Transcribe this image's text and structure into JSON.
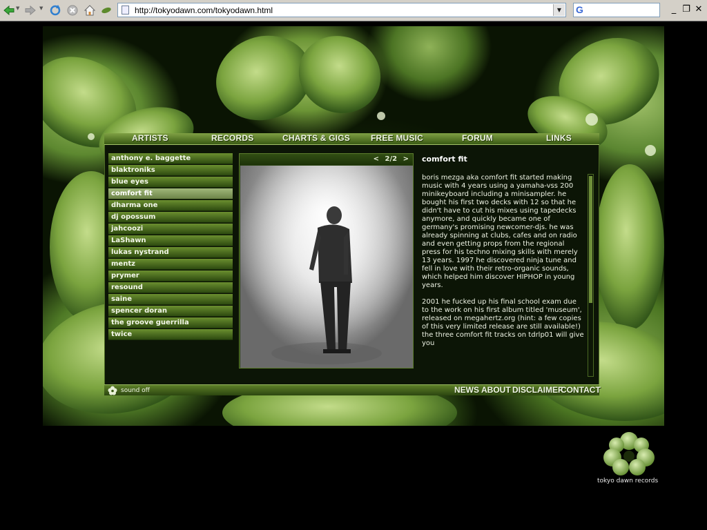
{
  "browser": {
    "url": "http://tokyodawn.com/tokyodawn.html",
    "search_logo": "G",
    "icons": [
      "back-icon",
      "forward-icon",
      "refresh-icon",
      "stop-icon",
      "home-icon",
      "leaf-icon"
    ],
    "window_controls": {
      "minimize": "_",
      "restore": "❐",
      "close": "✕"
    }
  },
  "site": {
    "top_nav": [
      "ARTISTS",
      "RECORDS",
      "CHARTS & GIGS",
      "FREE MUSIC",
      "FORUM",
      "LINKS"
    ],
    "artists": [
      "anthony e. baggette",
      "blaktroniks",
      "blue eyes",
      "comfort fit",
      "dharma one",
      "dj opossum",
      "jahcoozi",
      "LaShawn",
      "lukas nystrand",
      "mentz",
      "prymer",
      "resound",
      "saine",
      "spencer doran",
      "the groove guerrilla",
      "twice"
    ],
    "active_artist": "comfort fit",
    "photo": {
      "prev": "<",
      "page": "2/2",
      "next": ">"
    },
    "content": {
      "title": "comfort fit",
      "paragraphs": [
        " boris mezga aka comfort fit started making music with 4 years using a yamaha-vss 200 minikeyboard including a minisampler. he bought his first two decks with 12 so that he didn't have to cut his mixes using tapedecks anymore, and quickly became one of germany's promising newcomer-djs. he was already spinning at clubs, cafes and on radio and even getting props from the regional press for his techno mixing skills with merely 13 years. 1997 he discovered ninja tune and fell in love with their retro-organic sounds, which helped him discover HIPHOP in young years.",
        " 2001 he fucked up his final school exam due to the work on his first album titled 'museum', released on megahertz.org (hint: a few copies of this very limited release are still available!) the three comfort fit tracks on tdrlp01 will give you"
      ]
    },
    "sound_toggle": "sound off",
    "bottom_nav": [
      "NEWS",
      "ABOUT",
      "DISCLAIMER",
      "CONTACT"
    ],
    "logo_text": "tokyo dawn records"
  },
  "colors": {
    "accent_green": "#5d7f28",
    "active_item": "#8fa866",
    "page_bg": "#000000"
  }
}
